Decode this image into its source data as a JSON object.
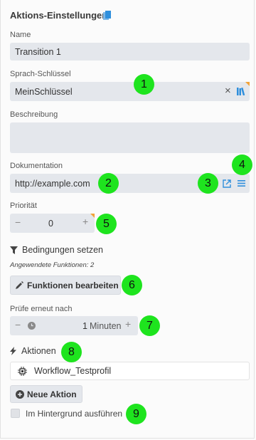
{
  "panel": {
    "title": "Aktions-Einstellungen",
    "name_label": "Name",
    "name_value": "Transition 1",
    "lang_key_label": "Sprach-Schlüssel",
    "lang_key_value": "MeinSchlüssel",
    "description_label": "Beschreibung",
    "description_value": "",
    "documentation_label": "Dokumentation",
    "documentation_value": "http://example.com",
    "priority_label": "Priorität",
    "priority_value": "0",
    "conditions_heading": "Bedingungen setzen",
    "applied_functions": "Angewendete Funktionen: 2",
    "edit_functions_button": "Funktionen bearbeiten",
    "recheck_label": "Prüfe erneut nach",
    "recheck_value": "1",
    "recheck_unit": "Minuten",
    "actions_heading": "Aktionen",
    "workflow_item": "Workflow_Testprofil",
    "new_action_button": "Neue Aktion",
    "background_checkbox_label": "Im Hintergrund ausführen",
    "minus": "−",
    "plus": "+",
    "clear": "×"
  },
  "markers": [
    "1",
    "2",
    "3",
    "4",
    "5",
    "6",
    "7",
    "8",
    "9"
  ],
  "colors": {
    "marker": "#1ee41e",
    "field_bg": "#e4e7ec",
    "corner_flag": "#f2a33a",
    "link_icon": "#2f8fdc"
  }
}
